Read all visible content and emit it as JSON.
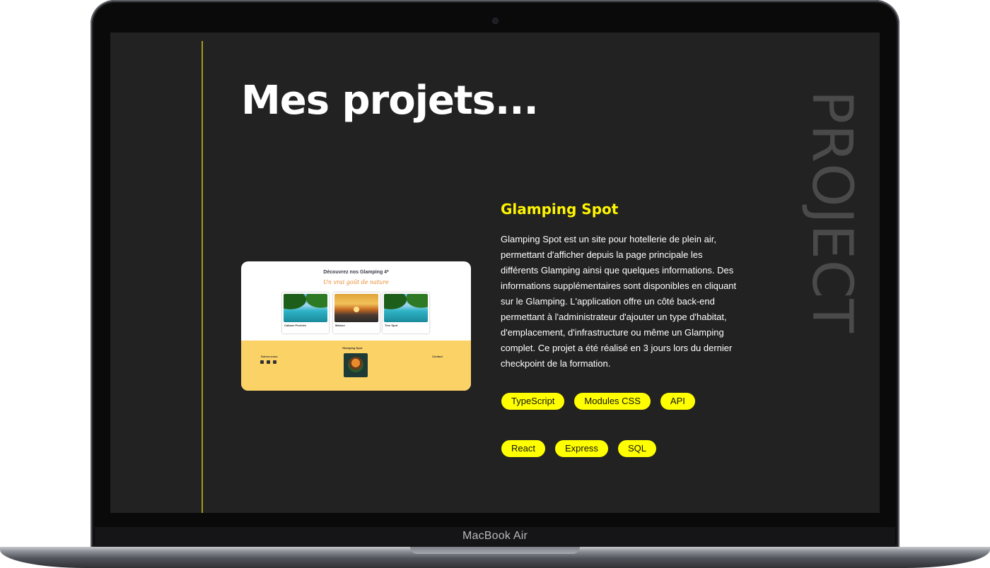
{
  "device": {
    "label": "MacBook Air"
  },
  "page": {
    "title": "Mes projets...",
    "side_word": "PROJECT"
  },
  "project": {
    "title": "Glamping Spot",
    "description": "Glamping Spot est un site pour hotellerie de plein air, permettant d'afficher depuis la page principale les différents Glamping ainsi que quelques informations. Des informations supplémentaires sont disponibles en cliquant sur le Glamping. L'application offre un côté back-end permettant à l'administrateur d'ajouter un type d'habitat, d'emplacement, d'infrastructure ou même un Glamping complet. Ce projet a été réalisé en 3 jours lors du dernier checkpoint de la formation.",
    "tags_row1": [
      "TypeScript",
      "Modules CSS",
      "API"
    ],
    "tags_row2": [
      "React",
      "Express",
      "SQL"
    ],
    "thumbnail": {
      "heading": "Découvrez nos Glamping 4*",
      "script_text": "Un vrai goût de nature",
      "cards": [
        {
          "title": "Cabane Perchée",
          "image": "lagoon"
        },
        {
          "title": "Maison",
          "image": "sunset"
        },
        {
          "title": "Tree Spot",
          "image": "lagoon"
        }
      ],
      "footer": {
        "left_title": "Suivez-nous",
        "center_title": "Glamping Spot",
        "right_title": "Contact",
        "logo_label": "Glamping Spot"
      }
    }
  },
  "colors": {
    "screen_bg": "#222222",
    "accent": "#ffff00",
    "title_accent": "#fff500",
    "divider": "#a59a1c",
    "side_word": "#4a4a4a",
    "thumb_footer": "#fbd265"
  }
}
